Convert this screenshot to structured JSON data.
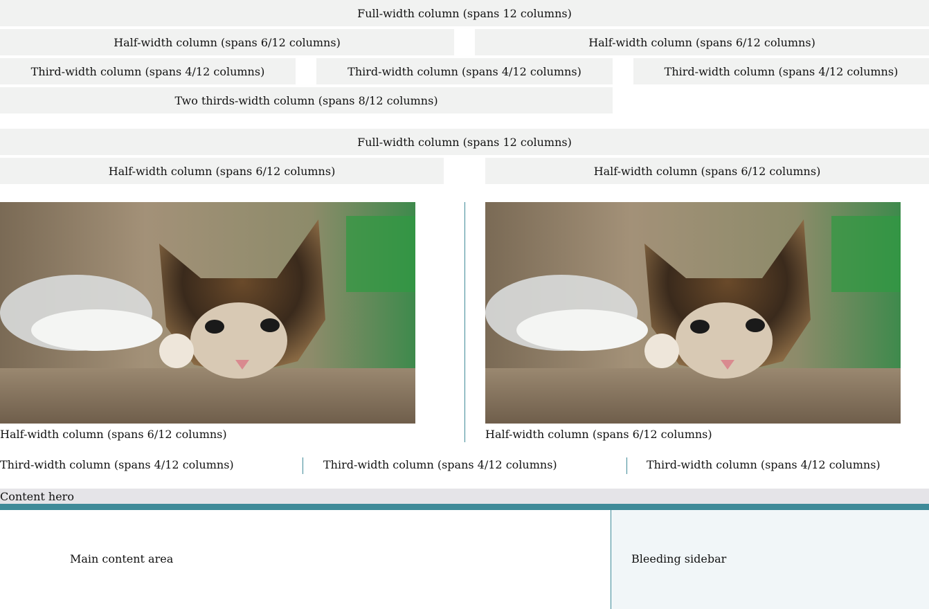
{
  "grid_section_1": {
    "row1": [
      "Full-width column (spans 12 columns)"
    ],
    "row2": [
      "Half-width column (spans 6/12 columns)",
      "Half-width column (spans 6/12 columns)"
    ],
    "row3": [
      "Third-width column (spans 4/12 columns)",
      "Third-width column (spans 4/12 columns)",
      "Third-width column (spans 4/12 columns)"
    ],
    "row4": [
      "Two thirds-width column (spans 8/12 columns)"
    ]
  },
  "grid_section_2": {
    "row1": [
      "Full-width column (spans 12 columns)"
    ],
    "row2": [
      "Half-width column (spans 6/12 columns)",
      "Half-width column (spans 6/12 columns)"
    ]
  },
  "media_row": {
    "captions": [
      "Half-width column (spans 6/12 columns)",
      "Half-width column (spans 6/12 columns)"
    ],
    "image_subject": "kitten"
  },
  "thirds_row": {
    "captions": [
      "Third-width column (spans 4/12 columns)",
      "Third-width column (spans 4/12 columns)",
      "Third-width column (spans 4/12 columns)"
    ]
  },
  "hero": {
    "label": "Content hero"
  },
  "layout": {
    "main_label": "Main content area",
    "sidebar_label": "Bleeding sidebar"
  },
  "colors": {
    "cell_bg": "#f1f2f1",
    "accent": "#3f8a98",
    "hero_bg": "#e5e4e8",
    "sidebar_bg": "#f1f6f8"
  }
}
